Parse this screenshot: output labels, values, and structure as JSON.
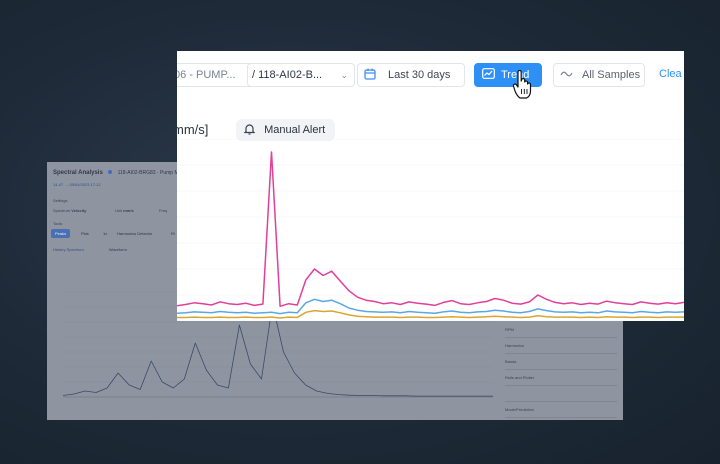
{
  "back_panel": {
    "title": "Spectral Analysis",
    "header_meta": "118-AI02-BRG83 · Pump Moto...",
    "subheader": "14-47 → 05/04/2023 17:12",
    "settings_label": "Settings",
    "spectrum_label": "Spectrum",
    "spectrum_value": "Velocity",
    "unit_label": "Unit",
    "unit_value": "mm/s",
    "freq_label": "Freq",
    "tools_label": "Tools",
    "tools": [
      "Peaks",
      "Pkts",
      "1x",
      "Harmonics Detector",
      "Ri"
    ],
    "view_tabs": [
      "History Spectrum",
      "Waveform"
    ],
    "side_items": [
      "RPM",
      "Harmonics",
      "Bands",
      "Rolls and Plotter",
      "",
      "Mode/Prediction"
    ]
  },
  "toolbar": {
    "crumb_prev": "06 - PUMP...",
    "crumb_current": "/ 118-AI02-B...",
    "date_range": "Last 30 days",
    "trend_label": "Trend",
    "samples_label": "All Samples",
    "clear_label": "Clea"
  },
  "unit_label": "mm/s]",
  "manual_alert_label": "Manual Alert",
  "icons": {
    "calendar": "calendar-icon",
    "trend": "trend-icon",
    "samples": "wave-icon",
    "bell": "bell-icon",
    "cursor": "hand-cursor-icon"
  },
  "colors": {
    "accent": "#2e90f5",
    "series_magenta": "#e0409a",
    "series_blue": "#5aa7e6",
    "series_gold": "#d9a530"
  },
  "chart_data": [
    {
      "type": "line",
      "series": [
        {
          "color": "#e0409a",
          "values": [
            0.35,
            0.38,
            0.42,
            0.4,
            0.37,
            0.44,
            0.4,
            0.38,
            0.41,
            0.36,
            0.39,
            3.9,
            0.34,
            0.4,
            0.37,
            0.95,
            1.2,
            1.05,
            1.15,
            0.92,
            0.7,
            0.55,
            0.48,
            0.45,
            0.4,
            0.42,
            0.38,
            0.44,
            0.41,
            0.39,
            0.36,
            0.43,
            0.47,
            0.4,
            0.38,
            0.42,
            0.45,
            0.52,
            0.48,
            0.41,
            0.39,
            0.44,
            0.6,
            0.5,
            0.43,
            0.4,
            0.42,
            0.38,
            0.41,
            0.39,
            0.46,
            0.42,
            0.4,
            0.38,
            0.44,
            0.41,
            0.39,
            0.42,
            0.4,
            0.43
          ]
        },
        {
          "color": "#5aa7e6",
          "values": [
            0.18,
            0.19,
            0.21,
            0.2,
            0.19,
            0.22,
            0.2,
            0.19,
            0.2,
            0.18,
            0.19,
            0.2,
            0.17,
            0.2,
            0.19,
            0.42,
            0.5,
            0.45,
            0.48,
            0.4,
            0.3,
            0.25,
            0.22,
            0.21,
            0.2,
            0.21,
            0.19,
            0.22,
            0.2,
            0.19,
            0.18,
            0.21,
            0.23,
            0.2,
            0.19,
            0.21,
            0.22,
            0.25,
            0.23,
            0.2,
            0.19,
            0.22,
            0.28,
            0.24,
            0.21,
            0.2,
            0.21,
            0.19,
            0.2,
            0.19,
            0.23,
            0.21,
            0.2,
            0.19,
            0.22,
            0.2,
            0.19,
            0.21,
            0.2,
            0.21
          ]
        },
        {
          "color": "#d9a530",
          "values": [
            0.08,
            0.08,
            0.09,
            0.08,
            0.08,
            0.09,
            0.08,
            0.08,
            0.09,
            0.08,
            0.08,
            0.09,
            0.07,
            0.09,
            0.08,
            0.2,
            0.24,
            0.22,
            0.23,
            0.19,
            0.14,
            0.11,
            0.1,
            0.09,
            0.09,
            0.09,
            0.08,
            0.09,
            0.09,
            0.08,
            0.08,
            0.09,
            0.1,
            0.09,
            0.08,
            0.09,
            0.1,
            0.11,
            0.1,
            0.09,
            0.08,
            0.09,
            0.12,
            0.1,
            0.09,
            0.09,
            0.09,
            0.08,
            0.09,
            0.08,
            0.1,
            0.09,
            0.09,
            0.08,
            0.09,
            0.09,
            0.08,
            0.09,
            0.09,
            0.09
          ]
        }
      ],
      "ylim": [
        0,
        4.2
      ],
      "grid": true
    },
    {
      "type": "line",
      "series": [
        {
          "color": "#3a4a66",
          "values": [
            0.05,
            0.1,
            0.2,
            0.15,
            0.3,
            0.8,
            0.4,
            0.25,
            1.2,
            0.5,
            0.3,
            0.6,
            1.8,
            0.9,
            0.4,
            0.3,
            2.4,
            1.1,
            0.6,
            3.1,
            1.5,
            0.8,
            0.4,
            0.2,
            0.12,
            0.08,
            0.06,
            0.05,
            0.05,
            0.04,
            0.04,
            0.04,
            0.03,
            0.03,
            0.03,
            0.03,
            0.03,
            0.03,
            0.03,
            0.03
          ]
        }
      ],
      "ylim": [
        0,
        3.5
      ],
      "grid": true
    }
  ]
}
